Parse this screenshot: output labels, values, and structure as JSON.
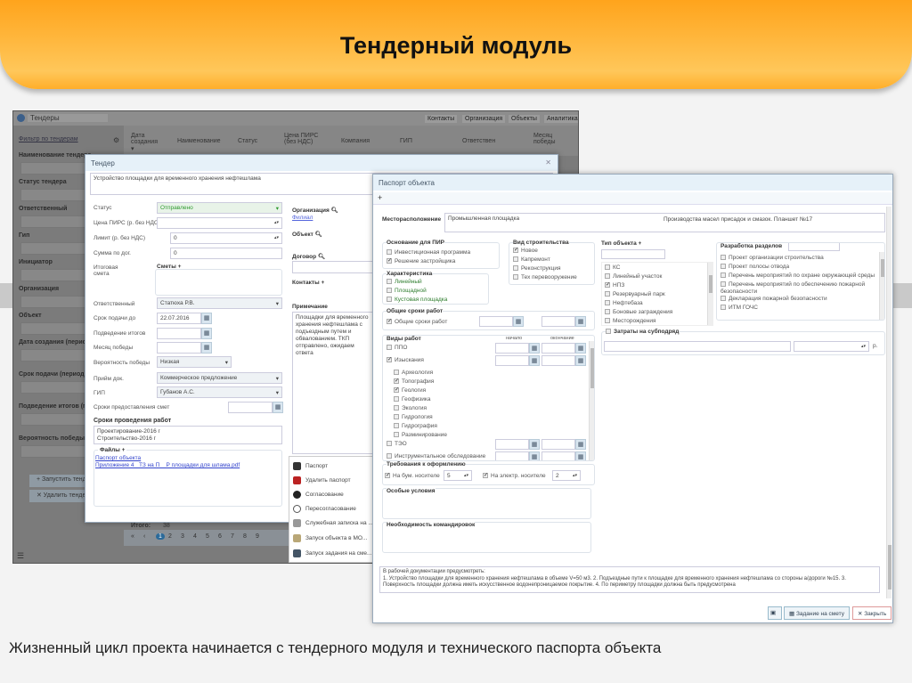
{
  "slide": {
    "title": "Тендерный модуль",
    "caption": "Жизненный цикл проекта начинается с тендерного модуля и технического паспорта объекта"
  },
  "app": {
    "title": "Тендеры",
    "tabs": [
      "Контакты",
      "Организация",
      "Объекты",
      "Аналитика"
    ],
    "filter_link": "Фильтр по тендерам",
    "filters": [
      "Наименование тендера",
      "Статус тендера",
      "Ответственный",
      "Гип",
      "Инициатор",
      "Организация",
      "Объект",
      "Дата создания (период)",
      "Срок подачи (период)",
      "Подведение итогов (период)",
      "Вероятность победы"
    ],
    "columns": [
      "Дата создания ▾",
      "Наименование",
      "Статус",
      "Цена ПИРС (без НДС)",
      "Компания",
      "ГИП",
      "Ответствен",
      "Месяц победы"
    ],
    "buttons": [
      "+ Запустить тендер",
      "✕ Удалить тендер"
    ],
    "total_label": "Итого:",
    "total_value": "38",
    "pages": [
      "«",
      "‹",
      "1",
      "2",
      "3",
      "4",
      "5",
      "6",
      "7",
      "8",
      "9"
    ]
  },
  "tender": {
    "title": "Тендер",
    "name": "Устройство площадки для временного хранения нефтешлама",
    "fields": {
      "status": {
        "label": "Статус",
        "value": "Отправлено"
      },
      "price": {
        "label": "Цена ПИРС (р. без НДС)",
        "value": ""
      },
      "limit": {
        "label": "Лимит (р. без НДС)",
        "value": "0"
      },
      "contract_sum": {
        "label": "Сумма по дог.",
        "value": "0"
      },
      "total_estimate": {
        "label": "Итоговая смета"
      },
      "estimates": {
        "label": "Сметы +"
      },
      "responsible": {
        "label": "Ответственный",
        "value": "Статюха Р.В."
      },
      "deadline": {
        "label": "Срок подачи до",
        "value": "22.07.2016"
      },
      "summary": {
        "label": "Подведение итогов",
        "value": ""
      },
      "win_month": {
        "label": "Месяц победы",
        "value": ""
      },
      "win_prob": {
        "label": "Вероятность победы",
        "value": "Низкая"
      },
      "doc_accept": {
        "label": "Прийм док.",
        "value": "Коммерческое предложение"
      },
      "gip": {
        "label": "ГИП",
        "value": "Губанов А.С."
      },
      "estimate_terms": {
        "label": "Сроки предоставления смет",
        "value": ""
      }
    },
    "work_terms_label": "Сроки проведения работ",
    "work_terms": "Проектирование-2016 г\nСтроительство-2016 г",
    "files_label": "Файлы +",
    "files": [
      "Паспорт объекта",
      "Приложение 4_ ТЗ на П__Р площадки для шлама.pdf"
    ],
    "right": {
      "org_label": "Организация",
      "org_link": "Филиал",
      "object_label": "Объект",
      "contract_label": "Договор",
      "contacts_label": "Контакты +",
      "note_label": "Примечание",
      "note": "Площадки для временного хранения нефтешлама с подъездным путем и обвалованием. ТКП отправлено, ожидаем ответа"
    },
    "menu": [
      "Паспорт",
      "Удалить паспорт",
      "Согласование",
      "Пересогласование",
      "Служебная записка на ...",
      "Запуск объекта в МО...",
      "Запуск задания на сме..."
    ]
  },
  "passport": {
    "title": "Паспорт объекта",
    "add": "+",
    "location_label": "Месторасположение",
    "location_value": "Промышленная площадка",
    "location_note": "Производства масел присадок и смазок. Планшет №17",
    "basis": {
      "legend": "Основание для ПИР",
      "items": [
        {
          "label": "Инвестиционная программа",
          "checked": false
        },
        {
          "label": "Решение застройщика",
          "checked": true
        }
      ]
    },
    "character": {
      "legend": "Характеристика",
      "items": [
        {
          "label": "Линейный",
          "checked": false
        },
        {
          "label": "Площадной",
          "checked": false
        },
        {
          "label": "Кустовая площадка",
          "checked": false
        }
      ]
    },
    "build_type": {
      "legend": "Вид строительства",
      "items": [
        {
          "label": "Новое",
          "checked": true
        },
        {
          "label": "Капремонт",
          "checked": false
        },
        {
          "label": "Реконструкция",
          "checked": false
        },
        {
          "label": "Тех перевооружение",
          "checked": false
        }
      ]
    },
    "object_type": {
      "legend": "Тип объекта +",
      "items": [
        {
          "label": "КС",
          "checked": false
        },
        {
          "label": "Линейный участок",
          "checked": false
        },
        {
          "label": "НПЗ",
          "checked": true
        },
        {
          "label": "Резервуарный парк",
          "checked": false
        },
        {
          "label": "Нефтебаза",
          "checked": false
        },
        {
          "label": "Боновые заграждения",
          "checked": false
        },
        {
          "label": "Месторождения",
          "checked": false
        }
      ]
    },
    "sections": {
      "legend": "Разработка разделов",
      "items": [
        {
          "label": "Проект организации строительства",
          "checked": false
        },
        {
          "label": "Проект полосы отвода",
          "checked": false
        },
        {
          "label": "Перечень мероприятий по охране окружающей среды",
          "checked": false
        },
        {
          "label": "Перечень мероприятий по обеспечению пожарной безопасности",
          "checked": false
        },
        {
          "label": "Декларация пожарной безопасности",
          "checked": false
        },
        {
          "label": "ИТМ ГОЧС",
          "checked": false
        }
      ]
    },
    "general_terms": {
      "legend": "Общие сроки работ",
      "item": {
        "label": "Общие сроки работ",
        "checked": true
      }
    },
    "subcontract": {
      "label": "Затраты на субподряд",
      "checked": false,
      "currency": "р."
    },
    "works": {
      "legend": "Виды работ",
      "start": "начало",
      "end": "окончание",
      "items": [
        {
          "label": "ППО",
          "checked": false,
          "sub": false
        },
        {
          "label": "Изыскания",
          "checked": true,
          "sub": false
        },
        {
          "label": "Археология",
          "checked": false,
          "sub": true
        },
        {
          "label": "Топография",
          "checked": true,
          "sub": true
        },
        {
          "label": "Геология",
          "checked": true,
          "sub": true
        },
        {
          "label": "Геофизика",
          "checked": false,
          "sub": true
        },
        {
          "label": "Экология",
          "checked": false,
          "sub": true
        },
        {
          "label": "Гидрология",
          "checked": false,
          "sub": true
        },
        {
          "label": "Гидрография",
          "checked": false,
          "sub": true
        },
        {
          "label": "Разминирование",
          "checked": false,
          "sub": true
        },
        {
          "label": "ТЭО",
          "checked": false,
          "sub": false
        },
        {
          "label": "Инструментальное обследование",
          "checked": false,
          "sub": false
        }
      ]
    },
    "requirements": {
      "legend": "Требования к оформлению",
      "paper_label": "На бум. носителе",
      "paper_value": "5",
      "digital_label": "На электр. носителе",
      "digital_value": "2"
    },
    "special_label": "Особые условия",
    "trips_label": "Необходимость командировок",
    "notes": "В рабочей документации предусмотреть:\n1. Устройство площадки для временного хранения нефтешлама в объеме V=50 м3. 2. Подъездные пути к площадке для временного хранения нефтешлама со стороны а/дороги №15. 3. Поверхность площадки должна иметь искусственное водонепроницаемое покрытие. 4. По периметру площадки должна быть предусмотрена",
    "btn_task": "Задание на смету",
    "btn_close": "✕ Закрыть"
  },
  "colors": {
    "banner": "#ffb53a",
    "status_green": "#2e9a2e",
    "link": "#3344cc"
  }
}
